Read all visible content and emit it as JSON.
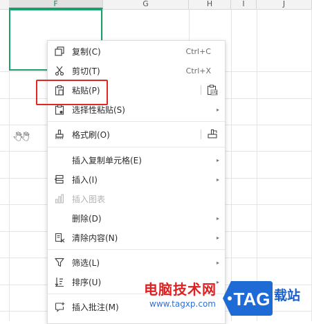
{
  "sheet": {
    "columns": [
      "F",
      "G",
      "H",
      "I",
      "J"
    ],
    "active_column": "F",
    "cursor_glyph": "🖑🖑"
  },
  "menu": {
    "items": [
      {
        "label": "复制(C)",
        "shortcut": "Ctrl+C",
        "icon": "copy-icon"
      },
      {
        "label": "剪切(T)",
        "shortcut": "Ctrl+X",
        "icon": "scissors-icon"
      },
      {
        "label": "粘贴(P)",
        "icon": "paste-icon",
        "right_icon": "paste-values-icon"
      },
      {
        "label": "选择性粘贴(S)",
        "icon": "paste-special-icon"
      },
      {
        "label": "格式刷(O)",
        "icon": "format-painter-icon",
        "right_icon": "format-painter-alt-icon"
      },
      {
        "label": "插入复制单元格(E)"
      },
      {
        "label": "插入(I)",
        "icon": "insert-icon"
      },
      {
        "label": "插入图表",
        "icon": "chart-icon",
        "disabled": true
      },
      {
        "label": "删除(D)"
      },
      {
        "label": "清除内容(N)",
        "icon": "eraser-icon"
      },
      {
        "label": "筛选(L)",
        "icon": "filter-icon"
      },
      {
        "label": "排序(U)",
        "icon": "sort-icon"
      },
      {
        "label": "插入批注(M)",
        "icon": "comment-icon"
      }
    ]
  },
  "watermark": {
    "text": "电脑技术网",
    "logo": "TAG",
    "side_text": "载站",
    "url": "www.tagxp.com"
  },
  "colors": {
    "selection": "#1aa16b",
    "highlight": "#e0261f",
    "watermark_red": "#e02020",
    "watermark_blue": "#1a5fd0"
  }
}
